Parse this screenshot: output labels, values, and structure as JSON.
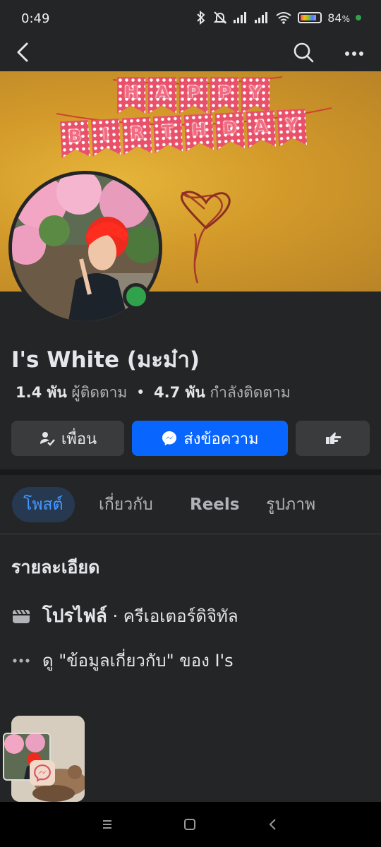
{
  "status": {
    "time": "0:49",
    "battery": "84",
    "battery_pct_sign": "%",
    "battery_level": 0.84,
    "icons": [
      "bluetooth-icon",
      "mute-icon",
      "signal-icon",
      "signal-icon",
      "wifi-icon",
      "battery-icon"
    ]
  },
  "cover": {
    "banner_line1": [
      "H",
      "A",
      "P",
      "P",
      "Y"
    ],
    "banner_line2": [
      "B",
      "I",
      "R",
      "T",
      "H",
      "D",
      "A",
      "Y"
    ]
  },
  "profile": {
    "name": "I's White (มะม๋า)",
    "followers_count": "1.4 พัน",
    "followers_label": "ผู้ติดตาม",
    "separator": "•",
    "following_count": "4.7 พัน",
    "following_label": "กำลังติดตาม",
    "online": true
  },
  "actions": {
    "friend_label": "เพื่อน",
    "message_label": "ส่งข้อความ"
  },
  "tabs": [
    "โพสต์",
    "เกี่ยวกับ",
    "Reels",
    "รูปภาพ"
  ],
  "details": {
    "title": "รายละเอียด",
    "profile_bold": "โปรไฟล์",
    "profile_rest": " · ครีเอเตอร์ดิจิทัล",
    "see_about": "ดู \"ข้อมูลเกี่ยวกับ\" ของ I's"
  },
  "colors": {
    "background": "#242526",
    "accent": "#0866ff",
    "online": "#31a24c",
    "active_tab_bg": "#263951",
    "active_tab_text": "#4599ff"
  }
}
